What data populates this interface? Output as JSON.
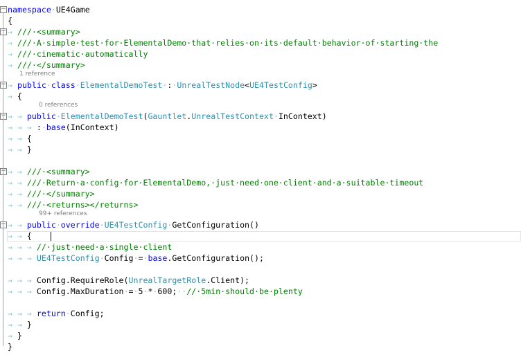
{
  "editor": {
    "lines": [
      {
        "kind": "code",
        "fold": "minus",
        "text": [
          [
            "kw",
            "namespace"
          ],
          [
            "ws",
            "·"
          ],
          [
            "pl",
            "UE4Game"
          ]
        ]
      },
      {
        "kind": "code",
        "text": [
          [
            "pl",
            "{"
          ]
        ]
      },
      {
        "kind": "code",
        "fold": "minus",
        "text": [
          [
            "ws",
            "→ "
          ],
          [
            "cm",
            "///·<summary>"
          ]
        ]
      },
      {
        "kind": "code",
        "text": [
          [
            "ws",
            "→ "
          ],
          [
            "cm",
            "///·A·simple·test·for·ElementalDemo·that·relies·on·its·default·behavior·of·starting·the"
          ]
        ]
      },
      {
        "kind": "code",
        "text": [
          [
            "ws",
            "→ "
          ],
          [
            "cm",
            "///·cinematic·automatically"
          ]
        ]
      },
      {
        "kind": "code",
        "text": [
          [
            "ws",
            "→ "
          ],
          [
            "cm",
            "///·</summary>"
          ]
        ]
      },
      {
        "kind": "ref",
        "text": "1 reference"
      },
      {
        "kind": "code",
        "fold": "minus",
        "text": [
          [
            "ws",
            "→ "
          ],
          [
            "kw",
            "public"
          ],
          [
            "ws",
            "·"
          ],
          [
            "kw",
            "class"
          ],
          [
            "ws",
            "·"
          ],
          [
            "ty",
            "ElementalDemoTest"
          ],
          [
            "ws",
            "·"
          ],
          [
            "pl",
            ":"
          ],
          [
            "ws",
            "·"
          ],
          [
            "ty",
            "UnrealTestNode"
          ],
          [
            "pl",
            "<"
          ],
          [
            "ty",
            "UE4TestConfig"
          ],
          [
            "pl",
            ">"
          ]
        ]
      },
      {
        "kind": "code",
        "text": [
          [
            "ws",
            "→ "
          ],
          [
            "pl",
            "{"
          ]
        ]
      },
      {
        "kind": "ref",
        "text": "0 references"
      },
      {
        "kind": "code",
        "fold": "minus",
        "text": [
          [
            "ws",
            "→ → "
          ],
          [
            "kw",
            "public"
          ],
          [
            "ws",
            "·"
          ],
          [
            "ty",
            "ElementalDemoTest"
          ],
          [
            "pl",
            "("
          ],
          [
            "ty",
            "Gauntlet"
          ],
          [
            "pl",
            "."
          ],
          [
            "ty",
            "UnrealTestContext"
          ],
          [
            "ws",
            "·"
          ],
          [
            "pl",
            "InContext)"
          ]
        ]
      },
      {
        "kind": "code",
        "text": [
          [
            "ws",
            "→ → → "
          ],
          [
            "pl",
            ":"
          ],
          [
            "ws",
            "·"
          ],
          [
            "kw",
            "base"
          ],
          [
            "pl",
            "(InContext)"
          ]
        ]
      },
      {
        "kind": "code",
        "text": [
          [
            "ws",
            "→ → "
          ],
          [
            "pl",
            "{"
          ]
        ]
      },
      {
        "kind": "code",
        "text": [
          [
            "ws",
            "→ → "
          ],
          [
            "pl",
            "}"
          ]
        ]
      },
      {
        "kind": "code",
        "text": []
      },
      {
        "kind": "code",
        "fold": "minus",
        "text": [
          [
            "ws",
            "→ → "
          ],
          [
            "cm",
            "///·<summary>"
          ]
        ]
      },
      {
        "kind": "code",
        "text": [
          [
            "ws",
            "→ → "
          ],
          [
            "cm",
            "///·Return·a·config·for·ElementalDemo,·just·need·one·client·and·a·suitable·timeout"
          ]
        ]
      },
      {
        "kind": "code",
        "text": [
          [
            "ws",
            "→ → "
          ],
          [
            "cm",
            "///·</summary>"
          ]
        ]
      },
      {
        "kind": "code",
        "text": [
          [
            "ws",
            "→ → "
          ],
          [
            "cm",
            "///·<returns></returns>"
          ]
        ]
      },
      {
        "kind": "ref",
        "text": "99+ references"
      },
      {
        "kind": "code",
        "fold": "minus",
        "text": [
          [
            "ws",
            "→ → "
          ],
          [
            "kw",
            "public"
          ],
          [
            "ws",
            "·"
          ],
          [
            "kw",
            "override"
          ],
          [
            "ws",
            "·"
          ],
          [
            "ty",
            "UE4TestConfig"
          ],
          [
            "ws",
            "·"
          ],
          [
            "pl",
            "GetConfiguration()"
          ]
        ]
      },
      {
        "kind": "code",
        "text": [
          [
            "ws",
            "→ → "
          ],
          [
            "pl",
            "{"
          ]
        ]
      },
      {
        "kind": "code",
        "text": [
          [
            "ws",
            "→ → → "
          ],
          [
            "cm",
            "//·just·need·a·single·client"
          ]
        ]
      },
      {
        "kind": "code",
        "text": [
          [
            "ws",
            "→ → → "
          ],
          [
            "ty",
            "UE4TestConfig"
          ],
          [
            "ws",
            "·"
          ],
          [
            "pl",
            "Config"
          ],
          [
            "ws",
            "·"
          ],
          [
            "pl",
            "="
          ],
          [
            "ws",
            "·"
          ],
          [
            "kw",
            "base"
          ],
          [
            "pl",
            ".GetConfiguration();"
          ]
        ]
      },
      {
        "kind": "code",
        "text": []
      },
      {
        "kind": "code",
        "text": [
          [
            "ws",
            "→ → → "
          ],
          [
            "pl",
            "Config.RequireRole("
          ],
          [
            "ty",
            "UnrealTargetRole"
          ],
          [
            "pl",
            ".Client);"
          ]
        ]
      },
      {
        "kind": "code",
        "text": [
          [
            "ws",
            "→ → → "
          ],
          [
            "pl",
            "Config.MaxDuration"
          ],
          [
            "ws",
            "·"
          ],
          [
            "pl",
            "="
          ],
          [
            "ws",
            "·"
          ],
          [
            "pl",
            "5"
          ],
          [
            "ws",
            "·"
          ],
          [
            "pl",
            "*"
          ],
          [
            "ws",
            "·"
          ],
          [
            "pl",
            "600;"
          ],
          [
            "ws",
            "··"
          ],
          [
            "cm",
            "//·5min·should·be·plenty"
          ]
        ]
      },
      {
        "kind": "code",
        "text": []
      },
      {
        "kind": "code",
        "text": [
          [
            "ws",
            "→ → → "
          ],
          [
            "kw",
            "return"
          ],
          [
            "ws",
            "·"
          ],
          [
            "pl",
            "Config;"
          ]
        ]
      },
      {
        "kind": "code",
        "text": [
          [
            "ws",
            "→ → "
          ],
          [
            "pl",
            "}"
          ]
        ]
      },
      {
        "kind": "code",
        "text": [
          [
            "ws",
            "→ "
          ],
          [
            "pl",
            "}"
          ]
        ]
      },
      {
        "kind": "code",
        "text": [
          [
            "pl",
            "}"
          ]
        ]
      }
    ]
  }
}
